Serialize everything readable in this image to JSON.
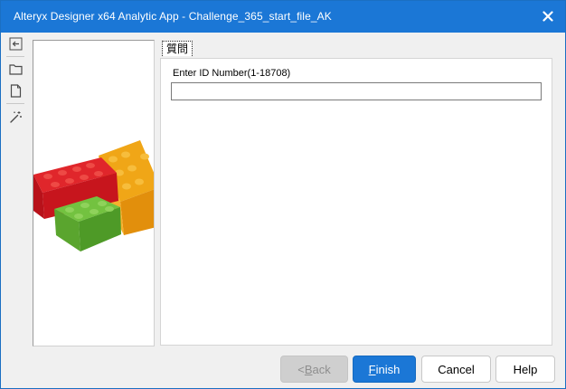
{
  "window": {
    "title": "Alteryx Designer x64 Analytic App - Challenge_365_start_file_AK",
    "close_icon": "close-icon"
  },
  "sidebar": {
    "items": [
      {
        "icon": "back-arrow-icon"
      },
      {
        "icon": "folder-open-icon"
      },
      {
        "icon": "document-icon"
      },
      {
        "icon": "magic-wand-icon"
      }
    ]
  },
  "tab": {
    "label": "質問"
  },
  "form": {
    "label": "Enter ID Number(1-18708)",
    "value": "",
    "placeholder": ""
  },
  "buttons": {
    "back": {
      "prefix": "< ",
      "mnemonic": "B",
      "rest": "ack",
      "enabled": false
    },
    "finish": {
      "prefix": "",
      "mnemonic": "F",
      "rest": "inish",
      "enabled": true
    },
    "cancel": {
      "label": "Cancel"
    },
    "help": {
      "label": "Help"
    }
  },
  "colors": {
    "titlebar": "#1b77d6",
    "finish": "#1b77d6",
    "lego_red": "#d9262a",
    "lego_yellow": "#f4a81a",
    "lego_green": "#6cbd3b"
  },
  "image": {
    "subject": "lego-bricks"
  }
}
